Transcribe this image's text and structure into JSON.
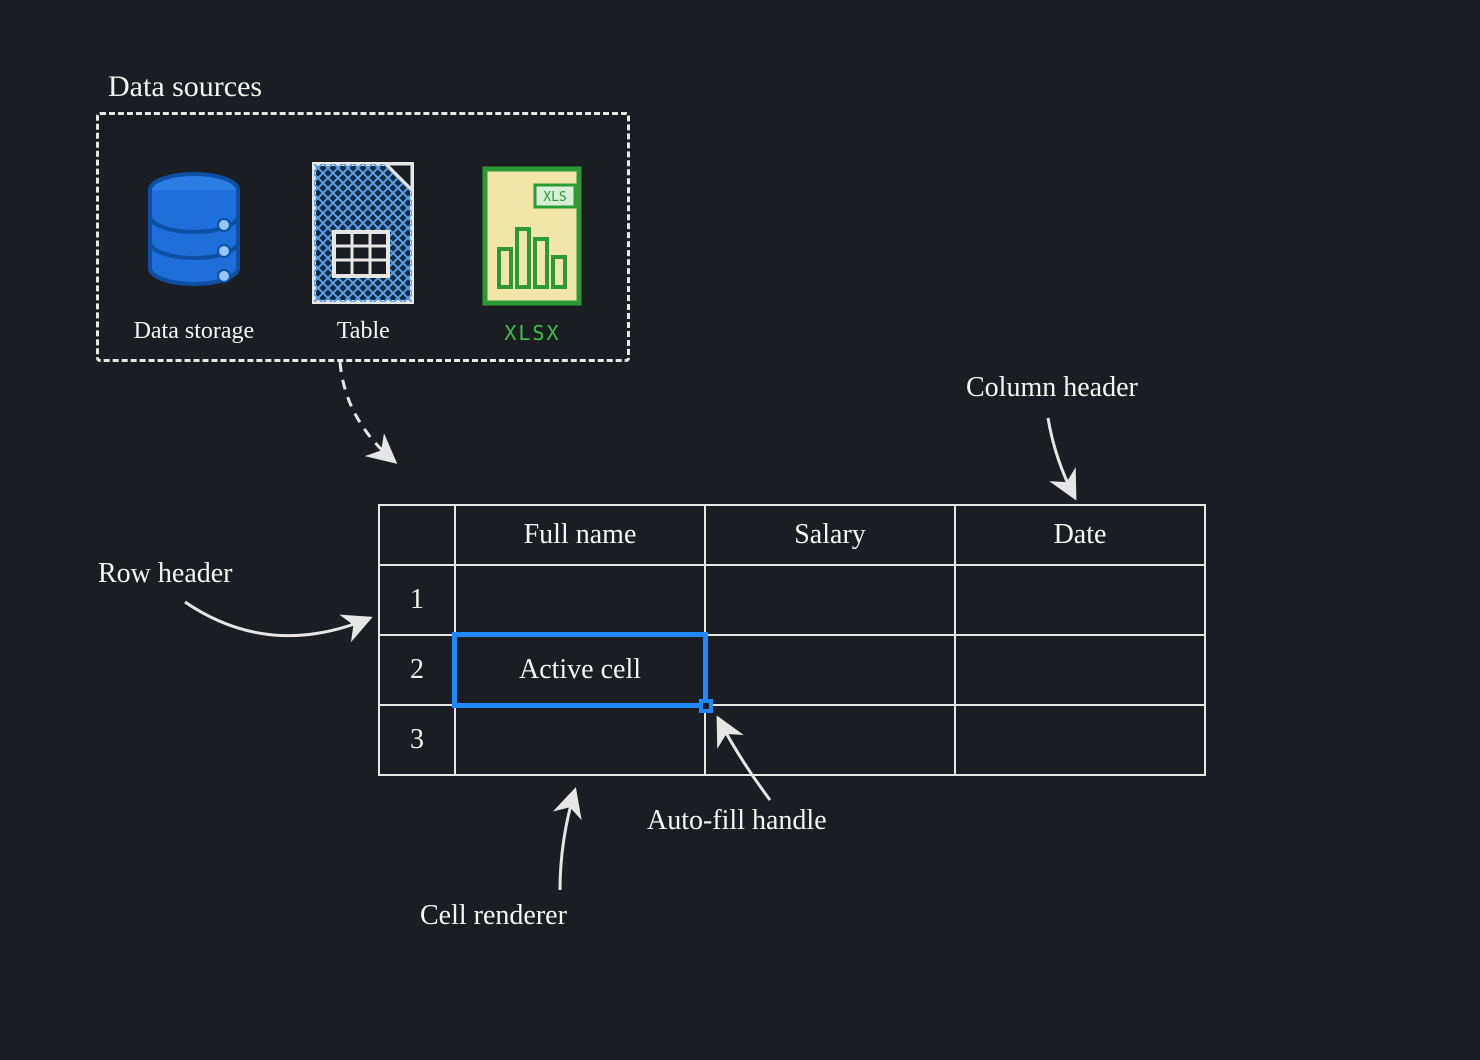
{
  "sections": {
    "data_sources_title": "Data sources",
    "sources": {
      "storage": "Data storage",
      "table": "Table",
      "xlsx": "XLSX",
      "xls_badge": "XLS"
    }
  },
  "annotations": {
    "row_header": "Row header",
    "column_header": "Column header",
    "autofill_handle": "Auto-fill handle",
    "cell_renderer": "Cell renderer"
  },
  "spreadsheet": {
    "columns": [
      "Full name",
      "Salary",
      "Date"
    ],
    "rows": [
      "1",
      "2",
      "3"
    ],
    "active_cell_text": "Active cell"
  },
  "colors": {
    "bg": "#1a1d21",
    "stroke": "#e6e6e6",
    "active": "#1e88ff",
    "db_blue": "#1e6fd9",
    "xlsx_green": "#3fbf4a",
    "xlsx_fill": "#f1e6a8"
  }
}
